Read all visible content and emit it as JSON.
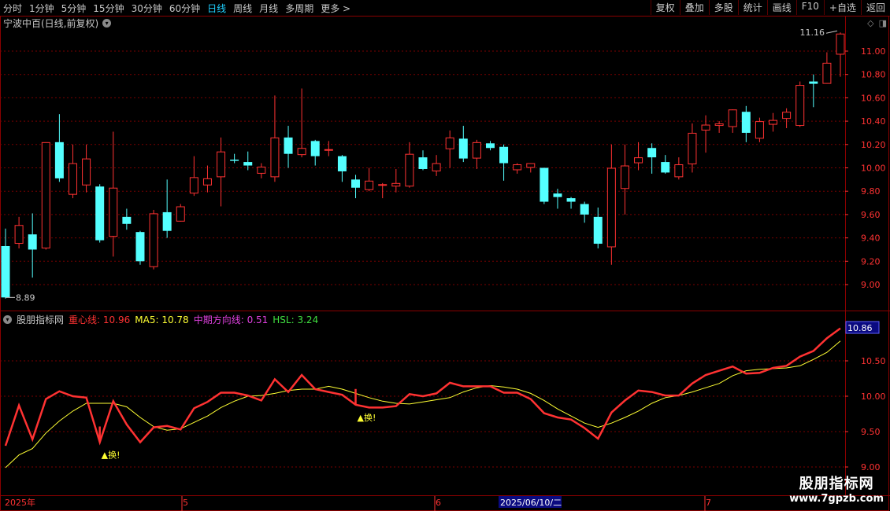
{
  "toolbar": {
    "periods": [
      "分时",
      "1分钟",
      "5分钟",
      "15分钟",
      "30分钟",
      "60分钟",
      "日线",
      "周线",
      "月线",
      "多周期",
      "更多 >"
    ],
    "active_period": "日线",
    "buttons": [
      "复权",
      "叠加",
      "多股",
      "统计",
      "画线",
      "F10",
      "+自选",
      "返回"
    ]
  },
  "main_chart": {
    "title": "宁波中百(日线,前复权)",
    "price_axis": [
      "11.00",
      "10.80",
      "10.60",
      "10.40",
      "10.20",
      "10.00",
      "9.80",
      "9.60",
      "9.40",
      "9.20",
      "9.00"
    ],
    "high_label": "11.16",
    "low_label": "8.89",
    "candles": [
      [
        9.33,
        8.89,
        9.48,
        8.88
      ],
      [
        9.35,
        9.51,
        9.58,
        9.31
      ],
      [
        9.43,
        9.3,
        9.61,
        9.06
      ],
      [
        9.31,
        10.22,
        10.22,
        9.3
      ],
      [
        10.22,
        9.91,
        10.46,
        9.88
      ],
      [
        9.77,
        10.04,
        10.2,
        9.74
      ],
      [
        9.85,
        10.08,
        10.2,
        9.79
      ],
      [
        9.84,
        9.38,
        9.86,
        9.36
      ],
      [
        9.41,
        9.83,
        10.31,
        9.24
      ],
      [
        9.58,
        9.52,
        9.65,
        9.47
      ],
      [
        9.45,
        9.2,
        9.46,
        9.17
      ],
      [
        9.15,
        9.61,
        9.64,
        9.13
      ],
      [
        9.62,
        9.46,
        9.9,
        9.4
      ],
      [
        9.54,
        9.67,
        9.69,
        9.54
      ],
      [
        9.78,
        9.92,
        10.1,
        9.76
      ],
      [
        9.85,
        9.91,
        10.02,
        9.79
      ],
      [
        9.92,
        10.14,
        10.26,
        9.67
      ],
      [
        10.07,
        10.06,
        10.12,
        10.04
      ],
      [
        10.05,
        10.02,
        10.14,
        9.98
      ],
      [
        9.95,
        10.01,
        10.04,
        9.91
      ],
      [
        9.92,
        10.26,
        10.62,
        9.88
      ],
      [
        10.26,
        10.12,
        10.36,
        10.0
      ],
      [
        10.11,
        10.17,
        10.68,
        10.09
      ],
      [
        10.23,
        10.1,
        10.24,
        10.02
      ],
      [
        10.16,
        10.16,
        10.23,
        10.1
      ],
      [
        10.1,
        9.97,
        10.11,
        9.88
      ],
      [
        9.9,
        9.83,
        9.94,
        9.74
      ],
      [
        9.81,
        9.89,
        10.0,
        9.8
      ],
      [
        9.86,
        9.86,
        9.87,
        9.74
      ],
      [
        9.84,
        9.87,
        9.99,
        9.79
      ],
      [
        9.84,
        10.12,
        10.22,
        9.83
      ],
      [
        10.09,
        9.99,
        10.15,
        9.98
      ],
      [
        9.97,
        10.04,
        10.11,
        9.93
      ],
      [
        10.16,
        10.26,
        10.32,
        10.0
      ],
      [
        10.25,
        10.08,
        10.36,
        10.05
      ],
      [
        10.08,
        10.22,
        10.24,
        9.99
      ],
      [
        10.21,
        10.17,
        10.23,
        10.15
      ],
      [
        10.18,
        10.04,
        10.2,
        9.89
      ],
      [
        9.98,
        10.03,
        10.04,
        9.95
      ],
      [
        10.0,
        10.04,
        10.04,
        9.96
      ],
      [
        10.0,
        9.71,
        10.0,
        9.69
      ],
      [
        9.78,
        9.75,
        9.82,
        9.65
      ],
      [
        9.74,
        9.71,
        9.75,
        9.65
      ],
      [
        9.69,
        9.6,
        9.71,
        9.53
      ],
      [
        9.58,
        9.35,
        9.66,
        9.31
      ],
      [
        9.32,
        10.0,
        10.2,
        9.17
      ],
      [
        9.82,
        10.02,
        10.2,
        9.6
      ],
      [
        10.04,
        10.09,
        10.22,
        9.98
      ],
      [
        10.17,
        10.09,
        10.21,
        9.95
      ],
      [
        10.05,
        9.96,
        10.11,
        9.95
      ],
      [
        9.92,
        10.03,
        10.09,
        9.9
      ],
      [
        10.03,
        10.3,
        10.38,
        9.96
      ],
      [
        10.32,
        10.37,
        10.45,
        10.13
      ],
      [
        10.36,
        10.38,
        10.4,
        10.3
      ],
      [
        10.35,
        10.5,
        10.5,
        10.3
      ],
      [
        10.48,
        10.3,
        10.53,
        10.22
      ],
      [
        10.25,
        10.4,
        10.43,
        10.22
      ],
      [
        10.37,
        10.41,
        10.47,
        10.31
      ],
      [
        10.42,
        10.48,
        10.51,
        10.34
      ],
      [
        10.36,
        10.71,
        10.74,
        10.35
      ],
      [
        10.74,
        10.72,
        10.8,
        10.52
      ],
      [
        10.72,
        10.9,
        10.99,
        10.72
      ],
      [
        10.97,
        11.15,
        11.16,
        10.78
      ]
    ]
  },
  "indicator": {
    "name": "股朋指标网",
    "values": [
      {
        "label": "重心线:",
        "value": "10.96",
        "color": "#ff3232"
      },
      {
        "label": "MA5:",
        "value": "10.78",
        "color": "#ffff33"
      },
      {
        "label": "中期方向线:",
        "value": "0.51",
        "color": "#e040e0"
      },
      {
        "label": "HSL:",
        "value": "3.24",
        "color": "#40e040"
      }
    ],
    "axis": [
      "10.86",
      "10.50",
      "10.00",
      "9.50",
      "9.00"
    ],
    "current_box": "10.86",
    "signal_label": "▲换!",
    "red_line": [
      9.3,
      9.87,
      9.39,
      9.96,
      10.07,
      10.0,
      9.98,
      9.35,
      9.93,
      9.6,
      9.35,
      9.56,
      9.58,
      9.53,
      9.83,
      9.92,
      10.05,
      10.05,
      10.01,
      9.94,
      10.24,
      10.06,
      10.3,
      10.1,
      10.06,
      10.02,
      9.88,
      9.84,
      9.84,
      9.86,
      10.03,
      10.0,
      10.04,
      10.19,
      10.14,
      10.14,
      10.14,
      10.05,
      10.05,
      9.96,
      9.76,
      9.7,
      9.67,
      9.55,
      9.4,
      9.77,
      9.94,
      10.08,
      10.06,
      10.01,
      10.01,
      10.18,
      10.3,
      10.36,
      10.42,
      10.32,
      10.33,
      10.4,
      10.43,
      10.56,
      10.64,
      10.82,
      10.96
    ],
    "yellow_line": [
      8.99,
      9.17,
      9.26,
      9.48,
      9.65,
      9.79,
      9.9,
      9.9,
      9.9,
      9.85,
      9.7,
      9.57,
      9.52,
      9.54,
      9.63,
      9.72,
      9.84,
      9.93,
      10.0,
      10.01,
      10.04,
      10.08,
      10.1,
      10.1,
      10.14,
      10.1,
      10.04,
      9.98,
      9.93,
      9.9,
      9.89,
      9.92,
      9.95,
      9.98,
      10.06,
      10.12,
      10.15,
      10.13,
      10.1,
      10.04,
      9.94,
      9.82,
      9.72,
      9.62,
      9.56,
      9.62,
      9.7,
      9.79,
      9.9,
      9.98,
      10.01,
      10.06,
      10.12,
      10.18,
      10.29,
      10.36,
      10.38,
      10.39,
      10.4,
      10.43,
      10.52,
      10.62,
      10.78
    ],
    "signals": [
      7,
      26
    ]
  },
  "date_axis": {
    "labels": [
      "2025年",
      "5",
      "6",
      "2025/06/10/二",
      "7"
    ]
  },
  "watermark": {
    "title": "股朋指标网",
    "url": "www.7gpzb.com"
  }
}
